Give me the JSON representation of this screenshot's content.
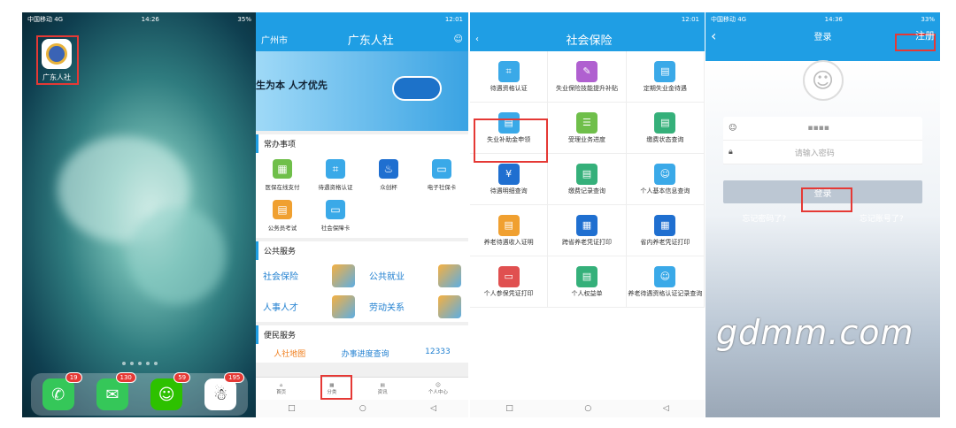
{
  "phone1": {
    "status": {
      "carrier": "中国移动 4G",
      "time": "14:26",
      "battery": "35%"
    },
    "app_label": "广东人社",
    "dock": [
      {
        "icon": "phone-icon",
        "badge": "19",
        "color": "#35c759"
      },
      {
        "icon": "messages-icon",
        "badge": "130",
        "color": "#35c759"
      },
      {
        "icon": "wechat-icon",
        "badge": "59",
        "color": "#2dc100"
      },
      {
        "icon": "qq-icon",
        "badge": "195",
        "color": "#ffffff"
      }
    ]
  },
  "phone2": {
    "status": {
      "time": "12:01"
    },
    "city": "广州市",
    "title": "广东人社",
    "banner_text": "生为本 人才优先",
    "section_common": "常办事项",
    "common_items": [
      {
        "label": "医保在线支付",
        "color": "#6fbf4a",
        "icon": "▦"
      },
      {
        "label": "待遇资格认证",
        "color": "#3aa9e8",
        "icon": "⌗"
      },
      {
        "label": "众创杯",
        "color": "#1f6fd0",
        "icon": "♨"
      },
      {
        "label": "电子社保卡",
        "color": "#3aa9e8",
        "icon": "▭"
      },
      {
        "label": "公务员考试",
        "color": "#f0a030",
        "icon": "▤"
      },
      {
        "label": "社会保障卡",
        "color": "#3aa9e8",
        "icon": "▭"
      }
    ],
    "section_public": "公共服务",
    "public_items": [
      "社会保险",
      "公共就业",
      "人事人才",
      "劳动关系"
    ],
    "section_convenience": "便民服务",
    "convenience_items": [
      "人社地图",
      "办事进度查询",
      "12333"
    ],
    "tabs": [
      "首页",
      "分类",
      "资讯",
      "个人中心"
    ]
  },
  "phone3": {
    "status": {
      "time": "12:01"
    },
    "title": "社会保险",
    "items": [
      {
        "label": "待遇资格认证",
        "color": "#3aa9e8"
      },
      {
        "label": "失业保险技能提升补贴",
        "color": "#b060d0"
      },
      {
        "label": "定期失业金待遇",
        "color": "#3aa9e8"
      },
      {
        "label": "失业补助金申领",
        "color": "#3aa9e8"
      },
      {
        "label": "受理业务进度",
        "color": "#6fbf4a"
      },
      {
        "label": "缴费状态查询",
        "color": "#35b07a"
      },
      {
        "label": "待遇明细查询",
        "color": "#1f6fd0"
      },
      {
        "label": "缴费记录查询",
        "color": "#35b07a"
      },
      {
        "label": "个人基本信息查询",
        "color": "#3aa9e8"
      },
      {
        "label": "养老待遇收入证明",
        "color": "#f0a030"
      },
      {
        "label": "跨省养老凭证打印",
        "color": "#1f6fd0"
      },
      {
        "label": "省内养老凭证打印",
        "color": "#1f6fd0"
      },
      {
        "label": "个人参保凭证打印",
        "color": "#e05050"
      },
      {
        "label": "个人权益单",
        "color": "#35b07a"
      },
      {
        "label": "养老待遇资格认证记录查询",
        "color": "#3aa9e8"
      }
    ]
  },
  "phone4": {
    "status": {
      "carrier": "中国移动 4G",
      "time": "14:36",
      "battery": "33%"
    },
    "title": "登录",
    "register": "注册",
    "username_value": "▪▪▪▪",
    "password_placeholder": "请输入密码",
    "login": "登录",
    "forgot_password": "忘记密码了?",
    "forgot_account": "忘记账号了?"
  },
  "watermark": "gdmm.com"
}
